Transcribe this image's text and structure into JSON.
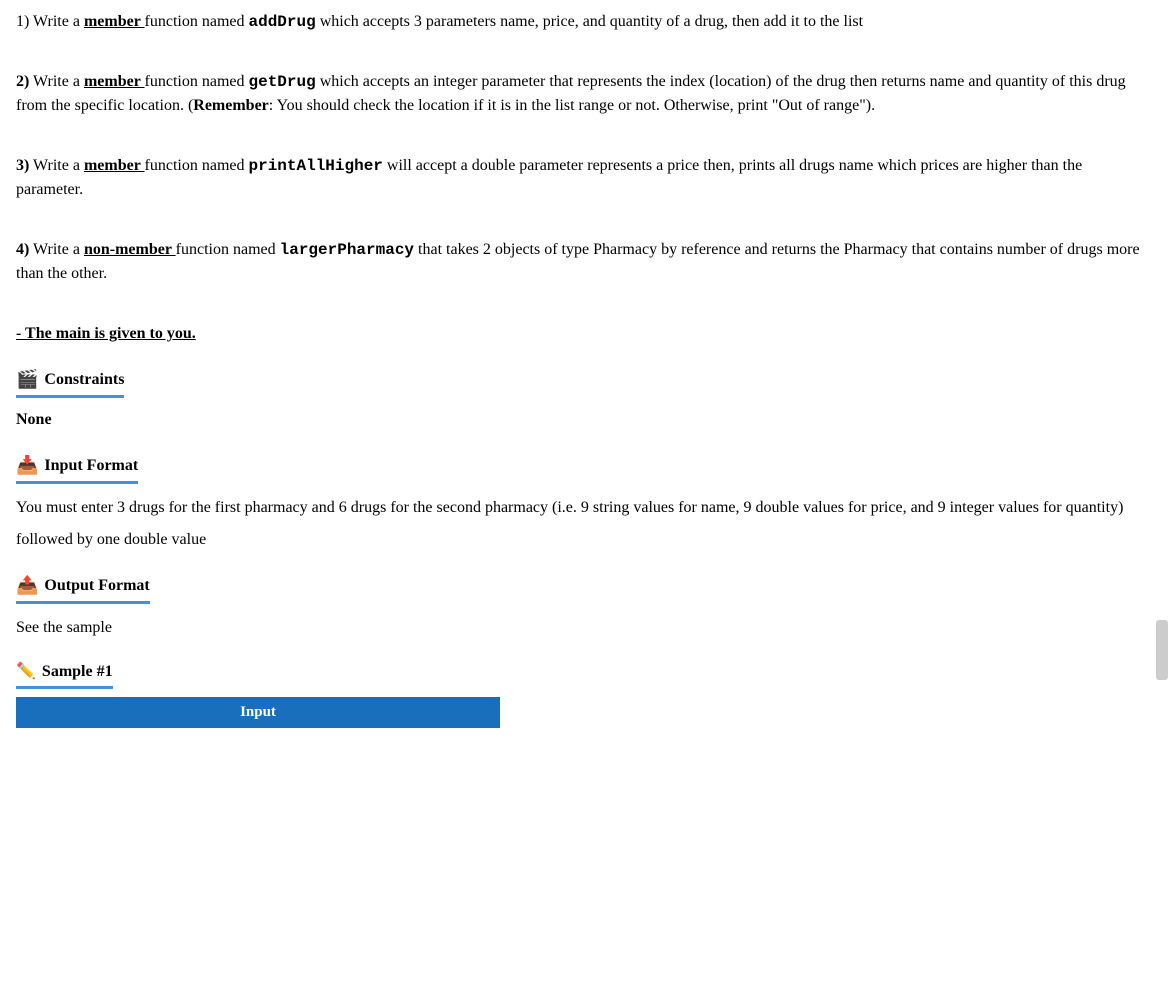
{
  "problem": {
    "item1": {
      "prefix": "1)",
      "text_before": "Write a",
      "underline_bold1": "member",
      "text_middle": "function named",
      "code1": "addDrug",
      "text_after": "which accepts 3 parameters name, price, and quantity of a drug, then add it to the list"
    },
    "item2": {
      "prefix": "2)",
      "text_before": "Write a",
      "underline_bold": "member",
      "text_middle": "function named",
      "code": "getDrug",
      "text_after": "which accepts an integer parameter that represents the index (location) of the drug then returns name and quantity of this drug from the specific location. (",
      "bold_remember": "Remember",
      "text_remember_after": ": You should check the location if it is in the list range or not. Otherwise, print \"Out of range\")."
    },
    "item3": {
      "prefix": "3)",
      "text_before": "Write a",
      "underline_bold": "member",
      "text_middle": "function named",
      "code": "printAllHigher",
      "text_after": "will accept a double parameter represents a price then, prints all drugs name which prices are higher than the parameter."
    },
    "item4": {
      "prefix": "4)",
      "text_before": "Write a",
      "underline_bold": "non-member",
      "text_middle": "function named",
      "code": "largerPharmacy",
      "text_after": "that takes 2 objects of type Pharmacy by reference and returns the Pharmacy that contains number of drugs more than the other."
    },
    "main_note": "- The main is given to you.",
    "constraints": {
      "title": "Constraints",
      "value": "None"
    },
    "input_format": {
      "title": "Input Format",
      "line1": "You must enter 3 drugs for the first pharmacy and 6 drugs for the second pharmacy (i.e. 9 string values for name, 9 double values for price, and 9 integer values for quantity)",
      "line2": "followed by one double value"
    },
    "output_format": {
      "title": "Output Format",
      "text": "See the sample"
    },
    "sample": {
      "title": "Sample #1",
      "input_tab": "Input"
    }
  }
}
